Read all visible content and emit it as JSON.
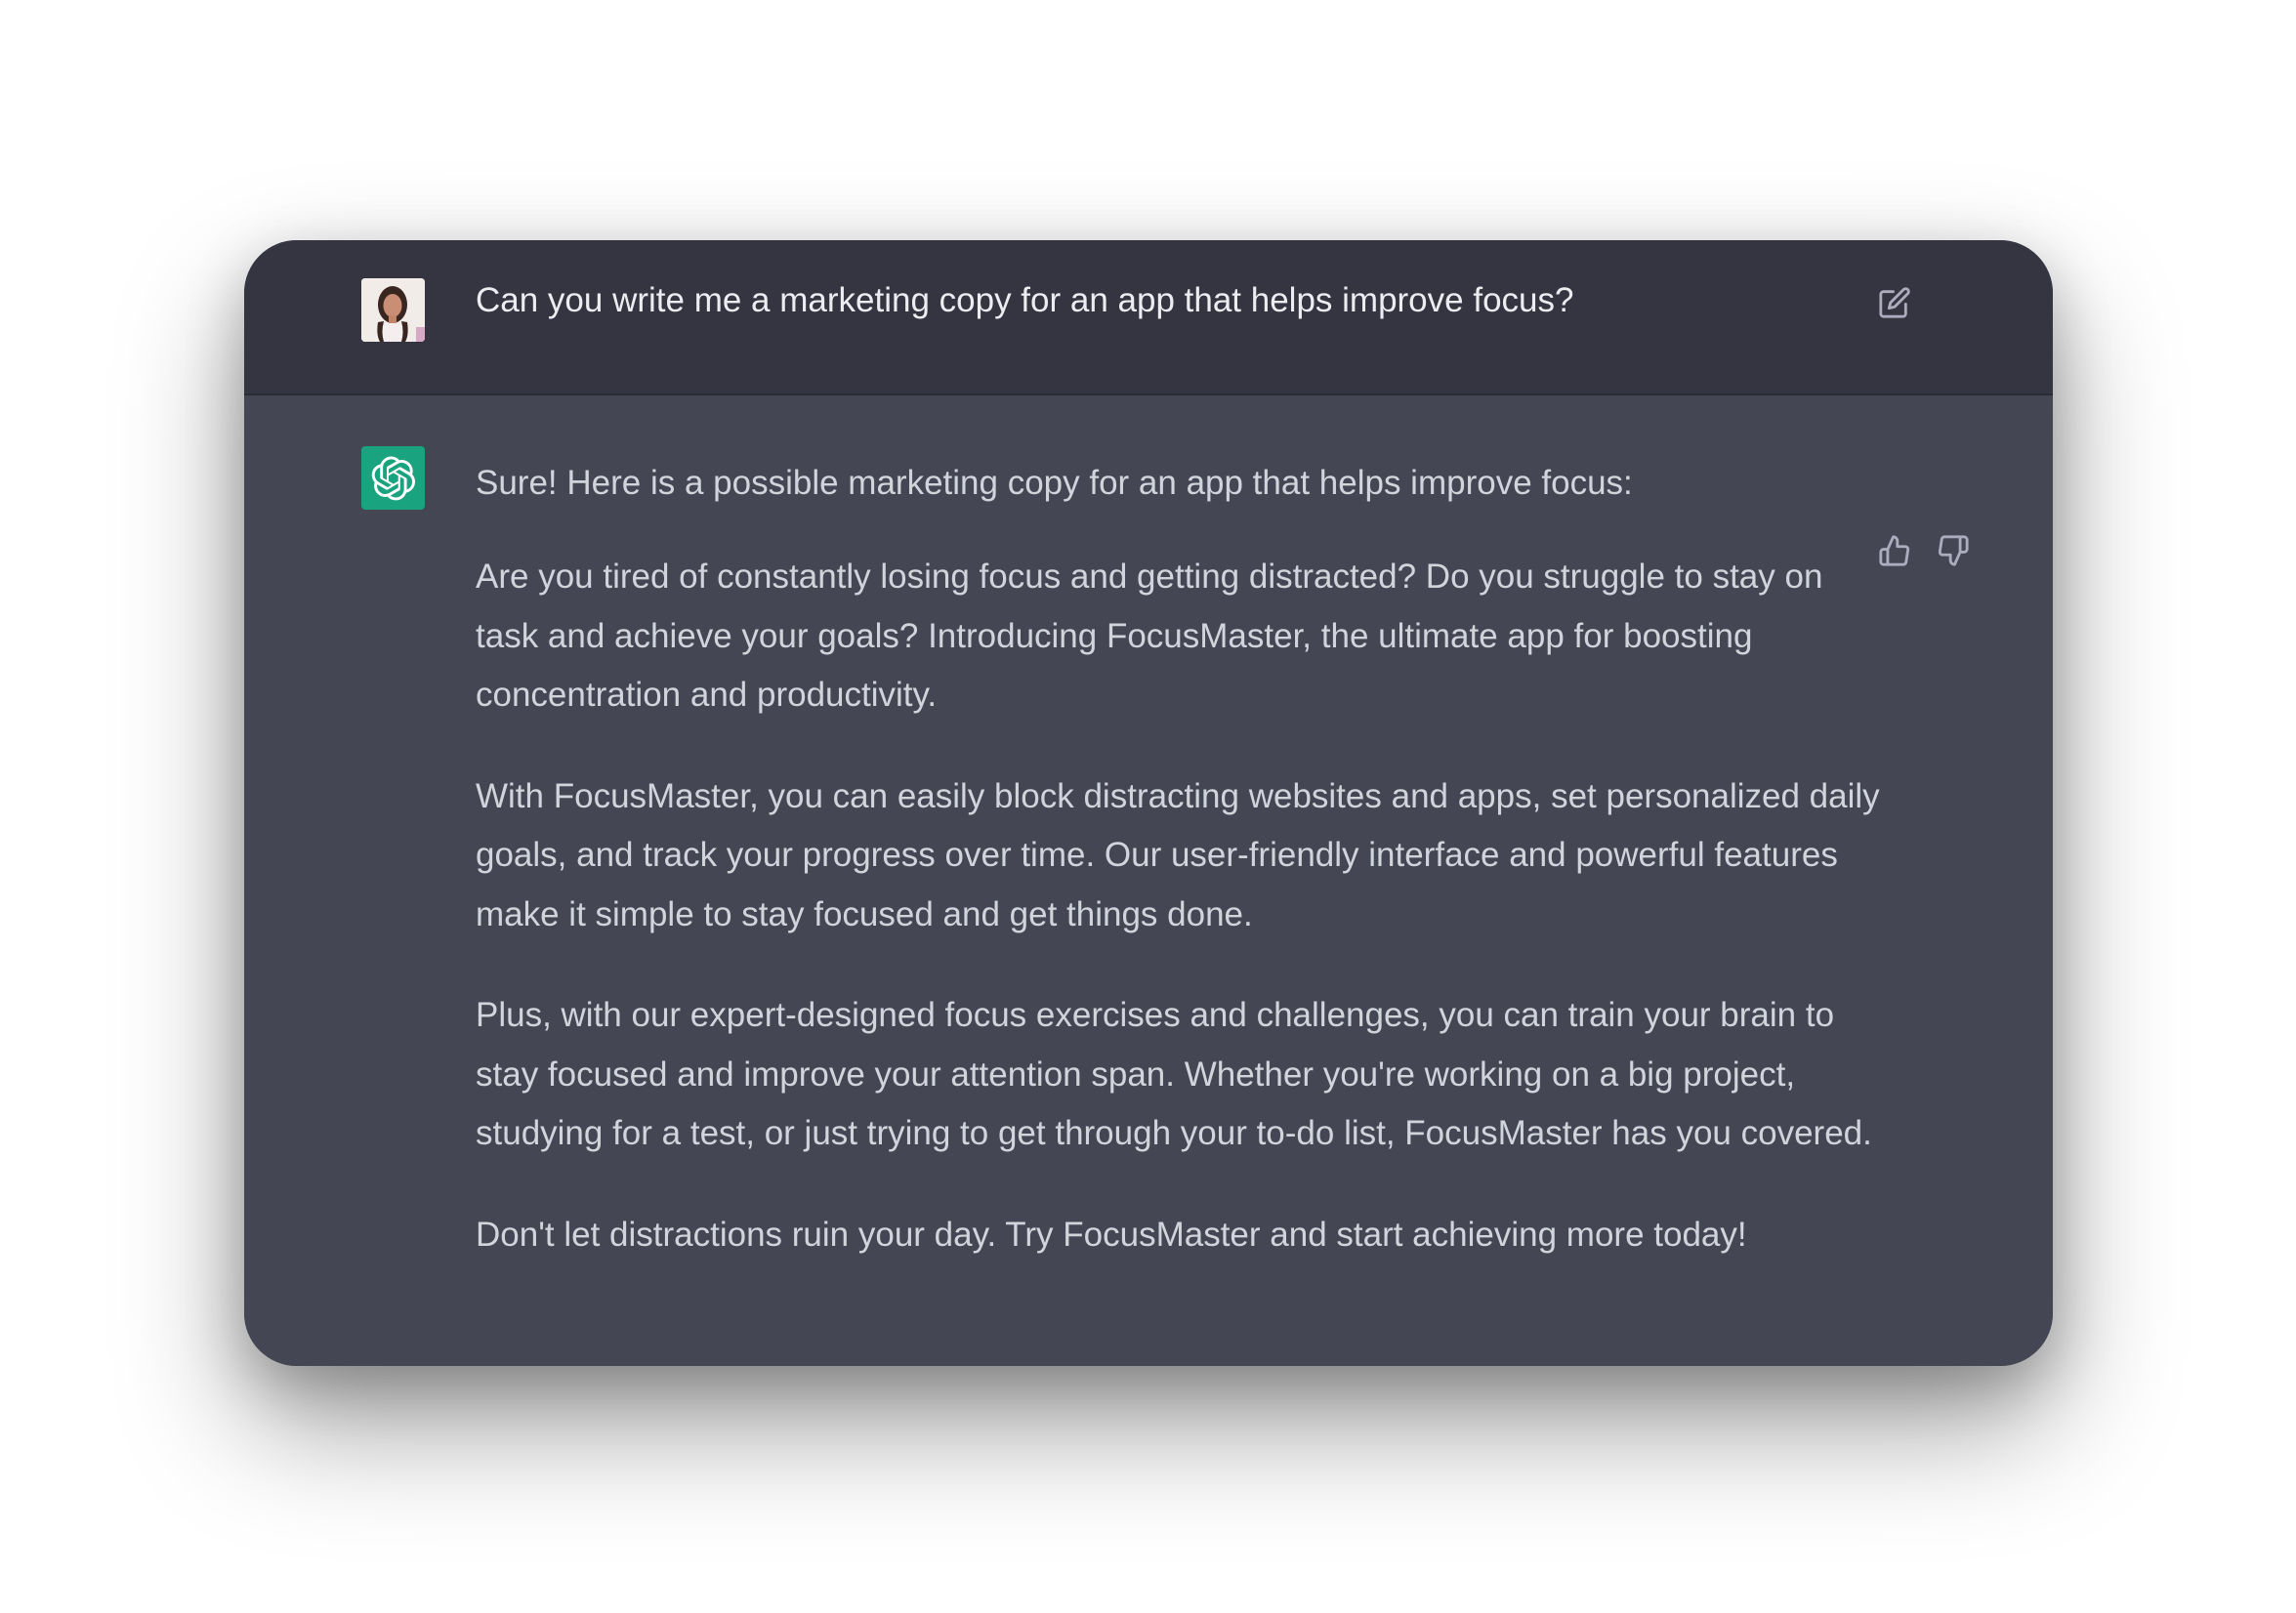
{
  "user_message": {
    "avatar": "user-photo-avatar",
    "text": "Can you write me a marketing copy for an app that helps improve focus?",
    "edit_icon": "edit-icon"
  },
  "assistant_message": {
    "avatar": "openai-logo-avatar",
    "accent_color": "#19a37f",
    "paragraphs": [
      "Sure! Here is a possible marketing copy for an app that helps improve focus:",
      "Are you tired of constantly losing focus and getting distracted? Do you struggle to stay on task and achieve your goals? Introducing FocusMaster, the ultimate app for boosting concentration and productivity.",
      "With FocusMaster, you can easily block distracting websites and apps, set personalized daily goals, and track your progress over time. Our user-friendly interface and powerful features make it simple to stay focused and get things done.",
      "Plus, with our expert-designed focus exercises and challenges, you can train your brain to stay focused and improve your attention span. Whether you're working on a big project, studying for a test, or just trying to get through your to-do list, FocusMaster has you covered.",
      "Don't let distractions ruin your day. Try FocusMaster and start achieving more today!"
    ],
    "feedback_icons": [
      "thumbs-up-icon",
      "thumbs-down-icon"
    ]
  },
  "colors": {
    "user_row_bg": "#343541",
    "assistant_row_bg": "#444654",
    "user_text": "#ececf1",
    "assistant_text": "#d1d5db",
    "icon": "#acacbe"
  }
}
